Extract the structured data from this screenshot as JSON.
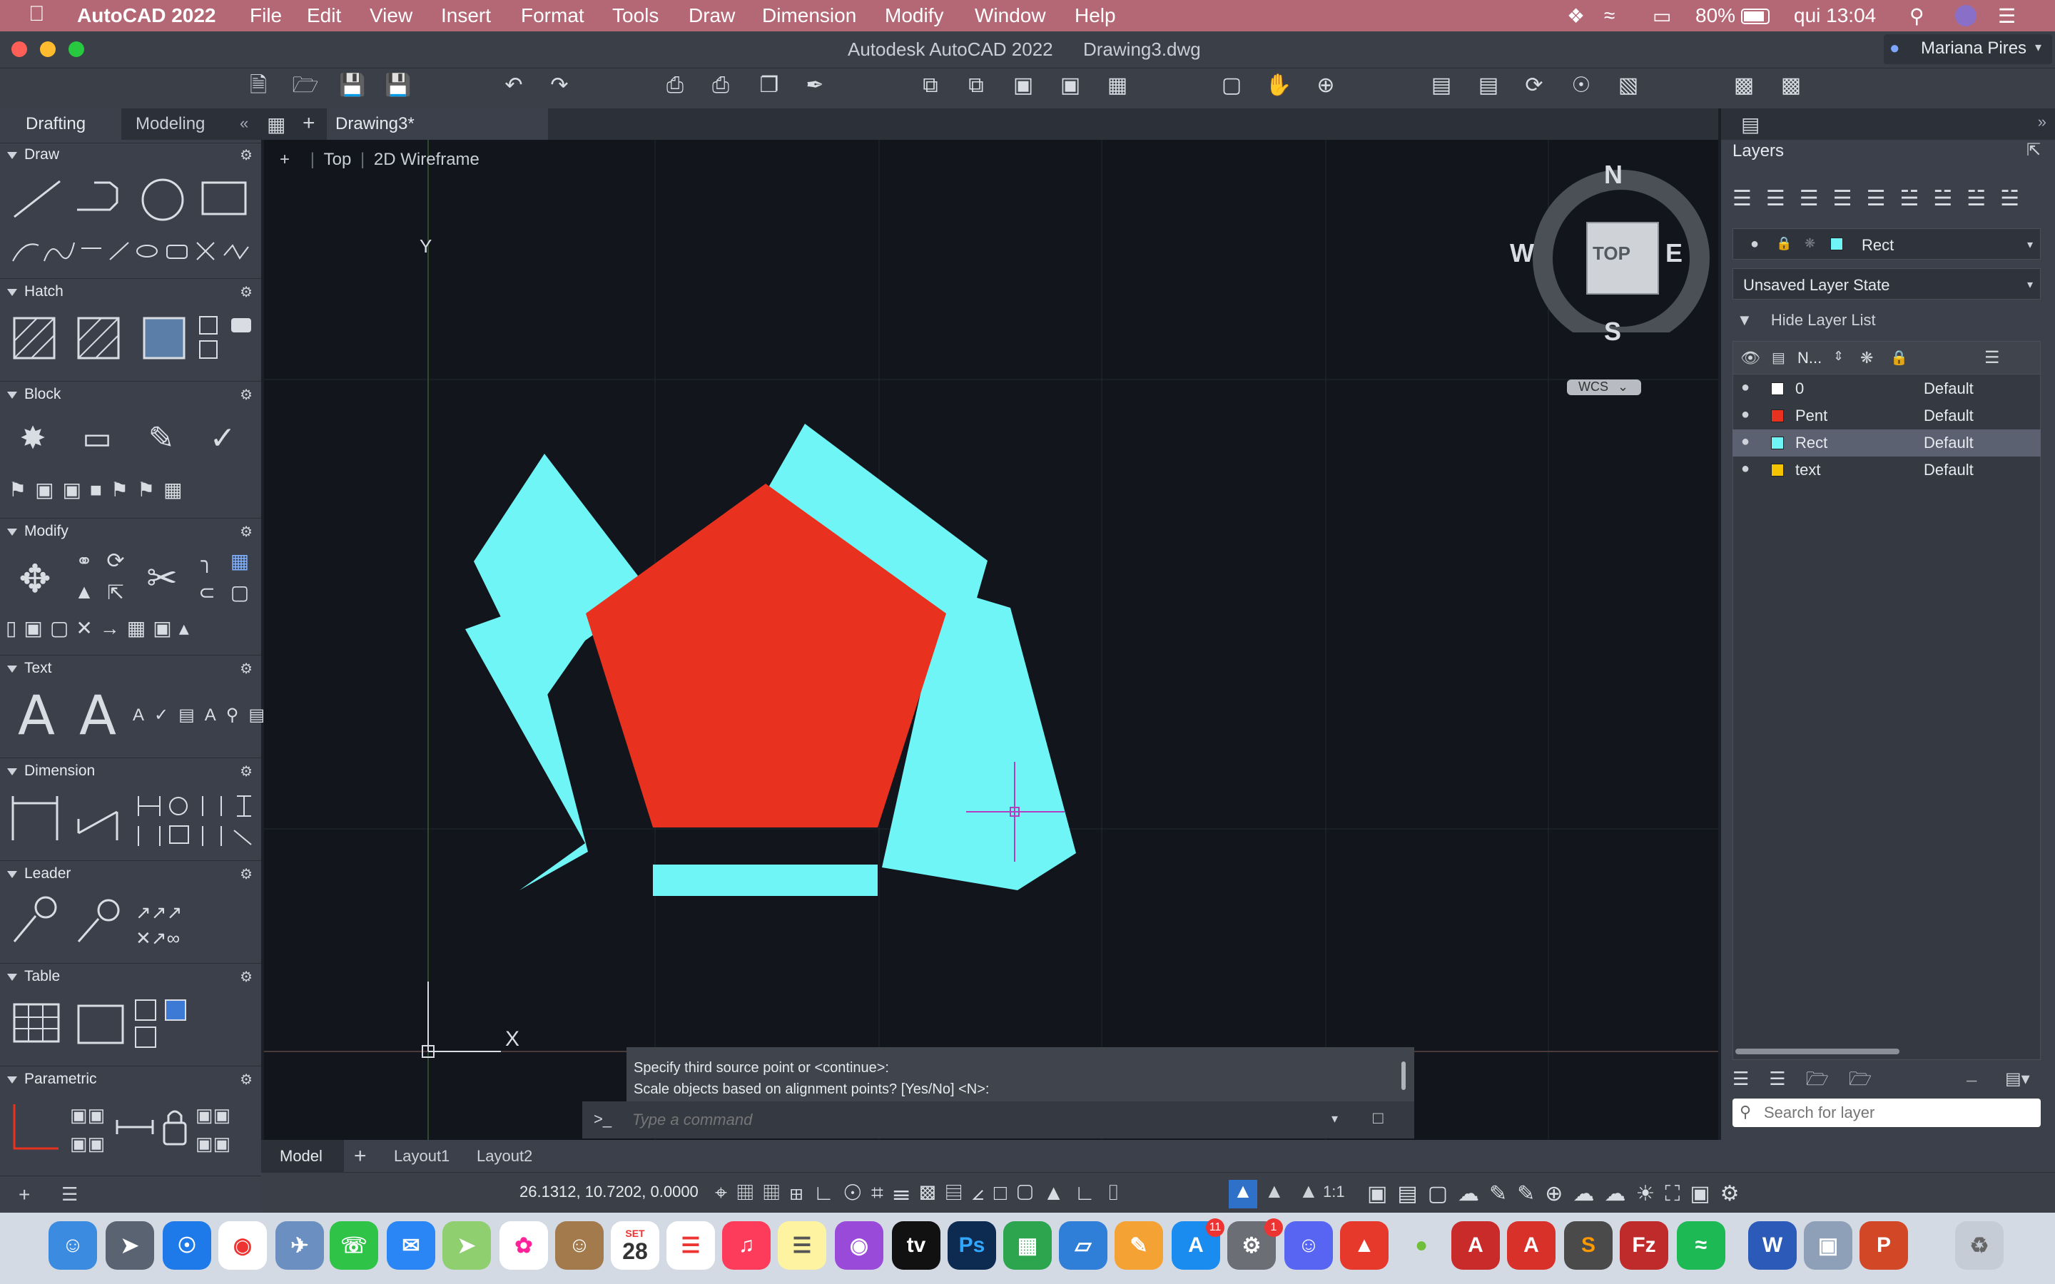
{
  "menubar": {
    "app_name": "AutoCAD 2022",
    "items": [
      "File",
      "Edit",
      "View",
      "Insert",
      "Format",
      "Tools",
      "Draw",
      "Dimension",
      "Modify",
      "Window",
      "Help"
    ],
    "battery": "80%",
    "clock": "qui 13:04"
  },
  "window": {
    "title": "Autodesk AutoCAD 2022",
    "file": "Drawing3.dwg",
    "user": "Mariana Pires"
  },
  "workspace_tabs": [
    "Drafting",
    "Modeling"
  ],
  "doc_tab": "Drawing3*",
  "viewport": {
    "view": "Top",
    "style": "2D Wireframe"
  },
  "viewcube": {
    "north": "N",
    "south": "S",
    "east": "E",
    "west": "W",
    "face": "TOP",
    "wcs": "WCS"
  },
  "ucs": {
    "x": "X",
    "y": "Y"
  },
  "panels": {
    "draw": "Draw",
    "hatch": "Hatch",
    "block": "Block",
    "modify": "Modify",
    "text": "Text",
    "dimension": "Dimension",
    "leader": "Leader",
    "table": "Table",
    "parametric": "Parametric"
  },
  "command": {
    "line1": "Specify third source point or <continue>:",
    "line2": "Scale objects based on alignment points? [Yes/No] <N>:",
    "prompt": ">_",
    "placeholder": "Type a command"
  },
  "layout_tabs": [
    "Model",
    "Layout1",
    "Layout2"
  ],
  "coordinates": "26.1312, 10.7202, 0.0000",
  "scale": "1:1",
  "layers_panel": {
    "title": "Layers",
    "current_layer": "Rect",
    "layer_state": "Unsaved Layer State",
    "hide_list": "Hide Layer List",
    "col_name": "N...",
    "search_placeholder": "Search for layer",
    "rows": [
      {
        "name": "0",
        "color": "#ffffff",
        "linetype": "Default"
      },
      {
        "name": "Pent",
        "color": "#e8321f",
        "linetype": "Default"
      },
      {
        "name": "Rect",
        "color": "#6ff5f6",
        "linetype": "Default"
      },
      {
        "name": "text",
        "color": "#f5c400",
        "linetype": "Default"
      }
    ]
  },
  "colors": {
    "pentagon": "#e8321f",
    "rect": "#6ff5f6",
    "canvas": "#12151b",
    "menubar": "#b46876"
  },
  "dock": {
    "calendar_day": "28",
    "calendar_month": "SET",
    "appstore_badge": "11",
    "settings_badge": "1"
  }
}
